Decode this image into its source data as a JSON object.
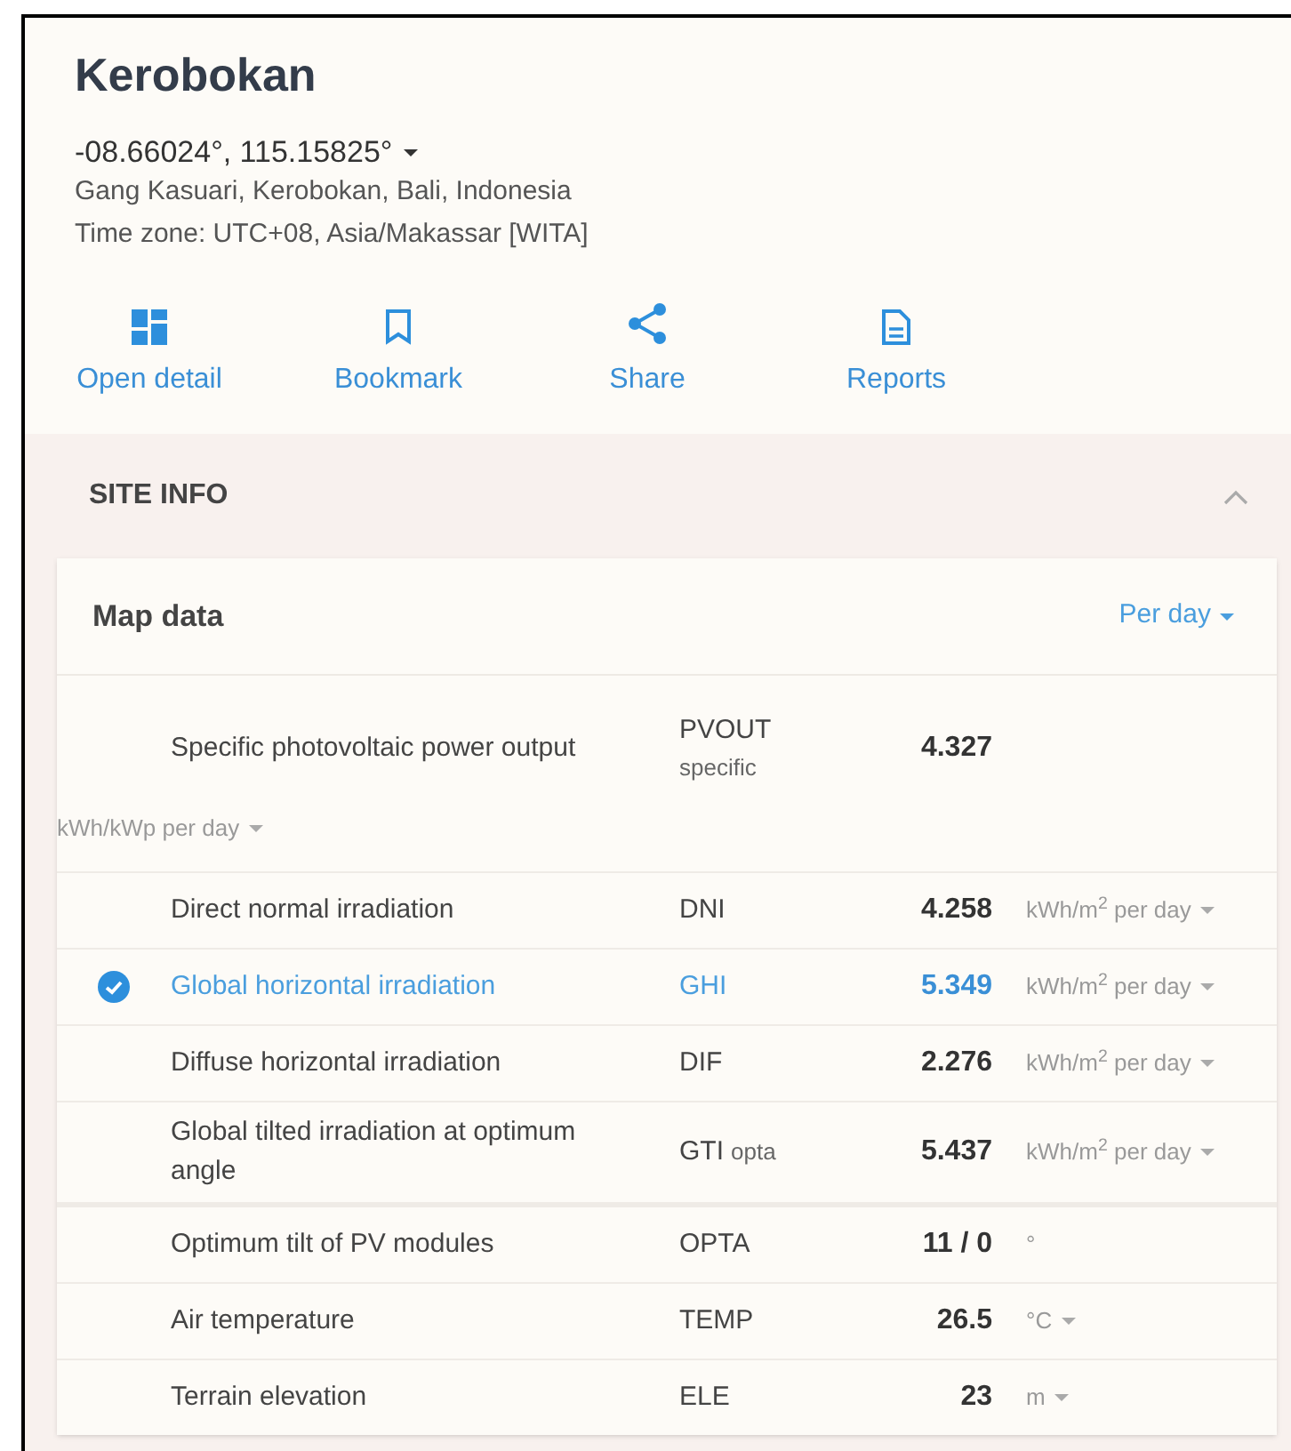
{
  "place": {
    "title": "Kerobokan",
    "coordinates": "-08.66024°, 115.15825°",
    "address": "Gang Kasuari, Kerobokan, Bali, Indonesia",
    "time_zone": "Time zone: UTC+08, Asia/Makassar [WITA]"
  },
  "actions": [
    {
      "kind": "detail",
      "label": "Open detail"
    },
    {
      "kind": "bookmark",
      "label": "Bookmark"
    },
    {
      "kind": "share",
      "label": "Share"
    },
    {
      "kind": "report",
      "label": "Reports"
    }
  ],
  "section": {
    "title": "SITE INFO",
    "expanded": true
  },
  "card": {
    "title": "Map data",
    "period": "Per day"
  },
  "row_groups": [
    {
      "rows": [
        {
          "name": "Specific photovoltaic power output",
          "code": "PVOUT",
          "code_sub": "specific",
          "value": "4.327",
          "unit": "kWh/kWp per day",
          "unit_dropdown": true,
          "unit_below": true,
          "selected": false
        },
        {
          "name": "Direct normal irradiation",
          "code": "DNI",
          "value": "4.258",
          "unit": "kWh/m$^{2}$ per day",
          "unit_dropdown": true,
          "unit_below": false,
          "selected": false
        },
        {
          "name": "Global horizontal irradiation",
          "code": "GHI",
          "value": "5.349",
          "unit": "kWh/m$^{2}$ per day",
          "unit_dropdown": true,
          "unit_below": false,
          "selected": true
        },
        {
          "name": "Diffuse horizontal irradiation",
          "code": "DIF",
          "value": "2.276",
          "unit": "kWh/m$^{2}$ per day",
          "unit_dropdown": true,
          "unit_below": false,
          "selected": false
        },
        {
          "name": "Global tilted irradiation at optimum angle",
          "code": "GTI",
          "code_sub": "opta",
          "value": "5.437",
          "unit": "kWh/m$^{2}$ per day",
          "unit_dropdown": true,
          "unit_below": false,
          "selected": false
        }
      ]
    },
    {
      "rows": [
        {
          "name": "Optimum tilt of PV modules",
          "code": "OPTA",
          "value": "11 / 0",
          "unit": "°",
          "unit_dropdown": false,
          "unit_below": false,
          "selected": false
        },
        {
          "name": "Air temperature",
          "code": "TEMP",
          "value": "26.5",
          "unit": "°C",
          "unit_dropdown": true,
          "unit_below": false,
          "selected": false
        },
        {
          "name": "Terrain elevation",
          "code": "ELE",
          "value": "23",
          "unit": "m",
          "unit_dropdown": true,
          "unit_below": false,
          "selected": false
        }
      ]
    }
  ]
}
